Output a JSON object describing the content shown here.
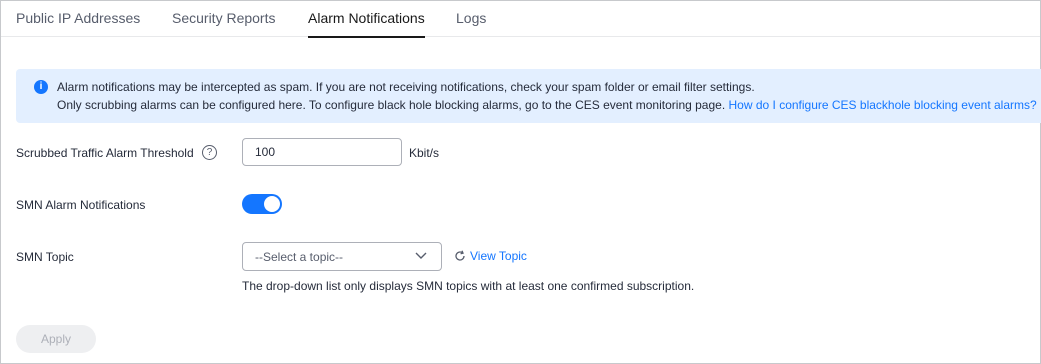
{
  "tabs": [
    {
      "label": "Public IP Addresses",
      "active": false
    },
    {
      "label": "Security Reports",
      "active": false
    },
    {
      "label": "Alarm Notifications",
      "active": true
    },
    {
      "label": "Logs",
      "active": false
    }
  ],
  "banner": {
    "icon": "info-icon",
    "line1": "Alarm notifications may be intercepted as spam. If you are not receiving notifications, check your spam folder or email filter settings.",
    "line2_text": "Only scrubbing alarms can be configured here. To configure black hole blocking alarms, go to the CES event monitoring page.",
    "line2_link": "How do I configure CES blackhole blocking event alarms?"
  },
  "form": {
    "threshold": {
      "label": "Scrubbed Traffic Alarm Threshold",
      "help_icon": "question-circle-icon",
      "value": "100",
      "unit": "Kbit/s"
    },
    "smn_notifications": {
      "label": "SMN Alarm Notifications",
      "enabled": true
    },
    "smn_topic": {
      "label": "SMN Topic",
      "placeholder": "--Select a topic--",
      "view_topic_label": "View Topic",
      "hint": "The drop-down list only displays SMN topics with at least one confirmed subscription."
    }
  },
  "actions": {
    "apply_label": "Apply",
    "apply_disabled": true
  },
  "colors": {
    "accent": "#1476ff",
    "banner_bg": "#e3efff",
    "text": "#252b3a"
  }
}
